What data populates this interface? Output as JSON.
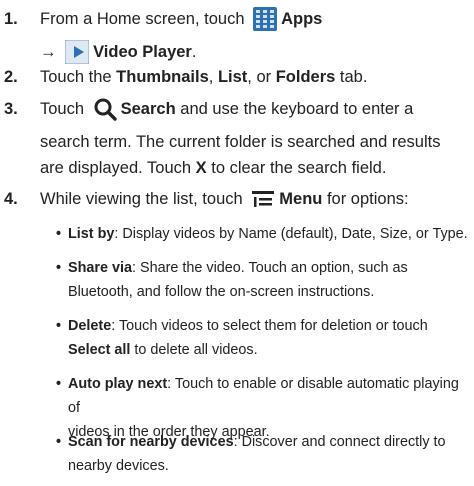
{
  "steps": [
    {
      "number": "1.",
      "line1_pre": "From a Home screen, touch",
      "apps_icon": "apps-grid-icon",
      "apps_label": "Apps",
      "arrow": "→",
      "video_icon": "video-player-icon",
      "video_label": "Video Player",
      "line2_post": "."
    },
    {
      "number": "2.",
      "pre": "Touch the",
      "thumbnails": "Thumbnails",
      "sep1": ",",
      "list": "List",
      "sep2": ", or",
      "folders": "Folders",
      "post": "tab."
    },
    {
      "number": "3.",
      "pre": "Touch",
      "search_icon": "search-icon",
      "search": "Search",
      "line1_post": "and use the keyboard to enter a",
      "line2": "search term. The current folder is searched and results",
      "line3_pre": "are displayed. Touch",
      "x_label": "X",
      "line3_post": "to clear the search field."
    },
    {
      "number": "4.",
      "pre": "While viewing the list, touch",
      "menu_icon": "menu-icon",
      "menu": "Menu",
      "post": "for options:"
    }
  ],
  "options": [
    {
      "term": "List by",
      "desc": ": Display videos by Name (default), Date, Size, or Type."
    },
    {
      "term": "Share via",
      "desc": ": Share the video. Touch an option, such as",
      "desc2": "Bluetooth, and follow the on-screen instructions."
    },
    {
      "term": "Delete",
      "desc": ": Touch videos to select them for deletion or touch",
      "term2": "Select all",
      "desc2": " to delete all videos."
    },
    {
      "term": "Auto play next",
      "desc": ": Touch to enable or disable automatic playing of",
      "desc2": "videos in the order they appear."
    },
    {
      "term": "Scan for nearby devices",
      "desc": ": Discover and connect directly to",
      "desc2": "nearby devices."
    }
  ],
  "bullet_char": "•",
  "colors": {
    "icon_blue": "#2f6fb3",
    "icon_light": "#cfe3f5",
    "text": "#222222"
  }
}
